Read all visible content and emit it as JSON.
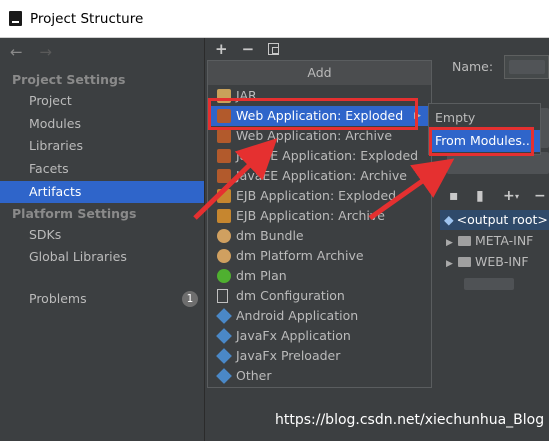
{
  "window": {
    "title": "Project Structure"
  },
  "left_nav": {
    "back": "←",
    "forward": "→"
  },
  "project_settings": {
    "header": "Project Settings",
    "items": [
      "Project",
      "Modules",
      "Libraries",
      "Facets",
      "Artifacts"
    ]
  },
  "platform_settings": {
    "header": "Platform Settings",
    "items": [
      "SDKs",
      "Global Libraries"
    ]
  },
  "problems": {
    "label": "Problems",
    "count": "1"
  },
  "toolbar": {
    "add": "+",
    "remove": "−"
  },
  "add_menu": {
    "title": "Add",
    "items": [
      {
        "label": "JAR",
        "icon": "jar-icon"
      },
      {
        "label": "Web Application: Exploded",
        "icon": "web-app-icon",
        "has_submenu": true,
        "selected": true
      },
      {
        "label": "Web Application: Archive",
        "icon": "web-app-icon"
      },
      {
        "label": "JavaEE Application: Exploded",
        "icon": "javaee-icon"
      },
      {
        "label": "JavaEE Application: Archive",
        "icon": "javaee-icon"
      },
      {
        "label": "EJB Application: Exploded",
        "icon": "ejb-icon"
      },
      {
        "label": "EJB Application: Archive",
        "icon": "ejb-icon"
      },
      {
        "label": "dm Bundle",
        "icon": "bundle-icon"
      },
      {
        "label": "dm Platform Archive",
        "icon": "bundle-icon"
      },
      {
        "label": "dm Plan",
        "icon": "plan-icon"
      },
      {
        "label": "dm Configuration",
        "icon": "config-icon"
      },
      {
        "label": "Android Application",
        "icon": "android-icon"
      },
      {
        "label": "JavaFx Application",
        "icon": "javafx-icon"
      },
      {
        "label": "JavaFx Preloader",
        "icon": "javafx-icon"
      },
      {
        "label": "Other",
        "icon": "other-icon"
      }
    ]
  },
  "submenu": {
    "items": [
      "Empty",
      "From Modules..."
    ]
  },
  "right_pane": {
    "name_label": "Name:",
    "tree": [
      {
        "label": "<output root>",
        "selected": true
      },
      {
        "label": "META-INF"
      },
      {
        "label": "WEB-INF"
      }
    ]
  },
  "watermark": "https://blog.csdn.net/xiechunhua_Blog",
  "colors": {
    "selection": "#2f65ca",
    "annotation": "#e53030",
    "background": "#3c3f41"
  }
}
